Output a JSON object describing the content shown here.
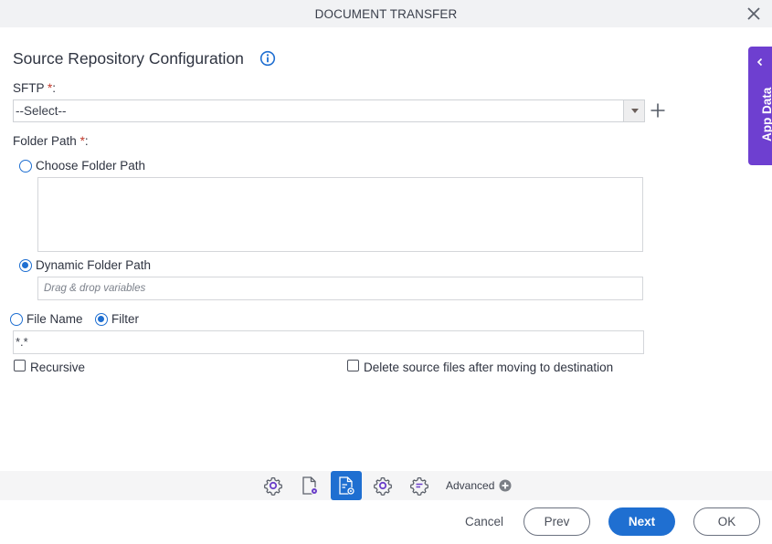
{
  "window": {
    "title": "DOCUMENT TRANSFER",
    "close_icon": "close-icon"
  },
  "section": {
    "title": "Source Repository Configuration",
    "info_icon": "info-icon"
  },
  "sftp": {
    "label": "SFTP",
    "required_mark": "*",
    "colon": ":",
    "selected_value": "--Select--",
    "add_icon": "plus-icon"
  },
  "folder_path": {
    "label": "Folder Path",
    "required_mark": "*",
    "colon": ":",
    "options": [
      {
        "label": "Choose Folder Path",
        "checked": false
      },
      {
        "label": "Dynamic Folder Path",
        "checked": true
      }
    ],
    "choose_value": "",
    "dynamic_placeholder": "Drag & drop variables",
    "dynamic_value": ""
  },
  "file_mode": {
    "options": [
      {
        "label": "File Name",
        "checked": false
      },
      {
        "label": "Filter",
        "checked": true
      }
    ],
    "value": "*.*"
  },
  "checkboxes": {
    "recursive": {
      "label": "Recursive",
      "checked": false
    },
    "delete_source": {
      "label": "Delete source files after moving to destination",
      "checked": false
    }
  },
  "side_panel": {
    "label": "App Data",
    "icon": "chevron-left-icon"
  },
  "toolbar": {
    "items": [
      {
        "icon": "settings-gear-icon",
        "active": false
      },
      {
        "icon": "document-settings-icon",
        "active": false
      },
      {
        "icon": "document-config-icon",
        "active": true
      },
      {
        "icon": "gear-icon",
        "active": false
      },
      {
        "icon": "gear-list-icon",
        "active": false
      }
    ],
    "advanced_label": "Advanced",
    "advanced_icon": "plus-circle-icon"
  },
  "footer": {
    "cancel": "Cancel",
    "prev": "Prev",
    "next": "Next",
    "ok": "OK"
  },
  "colors": {
    "accent": "#1f6fd1",
    "side_panel": "#6e3fd0",
    "required": "#c0392b",
    "icon_purple": "#6b3fc9"
  }
}
